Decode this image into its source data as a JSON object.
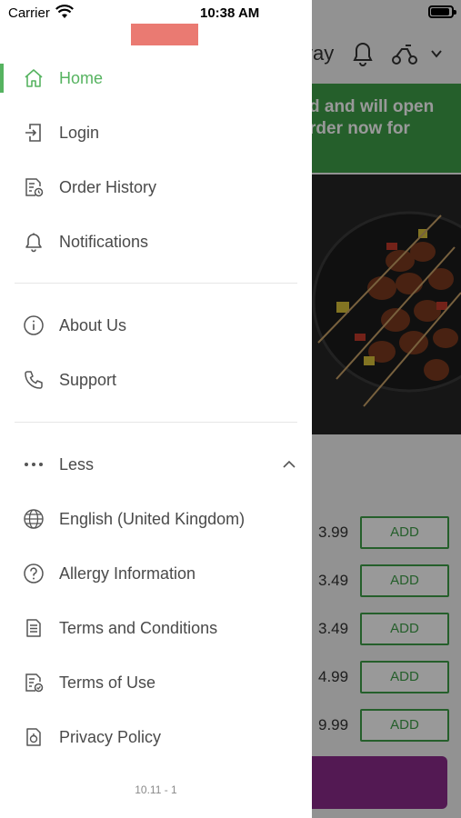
{
  "status_bar": {
    "carrier": "Carrier",
    "time": "10:38 AM"
  },
  "drawer": {
    "items_primary": [
      {
        "label": "Home",
        "icon": "home-icon",
        "active": true
      },
      {
        "label": "Login",
        "icon": "login-icon"
      },
      {
        "label": "Order History",
        "icon": "order-history-icon"
      },
      {
        "label": "Notifications",
        "icon": "bell-icon"
      }
    ],
    "items_secondary": [
      {
        "label": "About Us",
        "icon": "info-icon"
      },
      {
        "label": "Support",
        "icon": "phone-icon"
      }
    ],
    "less_label": "Less",
    "items_more": [
      {
        "label": "English (United Kingdom)",
        "icon": "globe-icon"
      },
      {
        "label": "Allergy Information",
        "icon": "question-icon"
      },
      {
        "label": "Terms and Conditions",
        "icon": "document-icon"
      },
      {
        "label": "Terms of Use",
        "icon": "document-check-icon"
      },
      {
        "label": "Privacy Policy",
        "icon": "privacy-icon"
      }
    ],
    "version": "10.11 - 1",
    "accent_color": "#56b360"
  },
  "background_page": {
    "header_title_fragment": "vay",
    "banner_line1": "d and will open",
    "banner_line2": "rder now for",
    "prices": [
      "3.99",
      "3.49",
      "3.49",
      "4.99",
      "9.99"
    ],
    "add_label": "ADD",
    "banner_color": "#3e9e49",
    "cart_color": "#8a2a8a"
  }
}
